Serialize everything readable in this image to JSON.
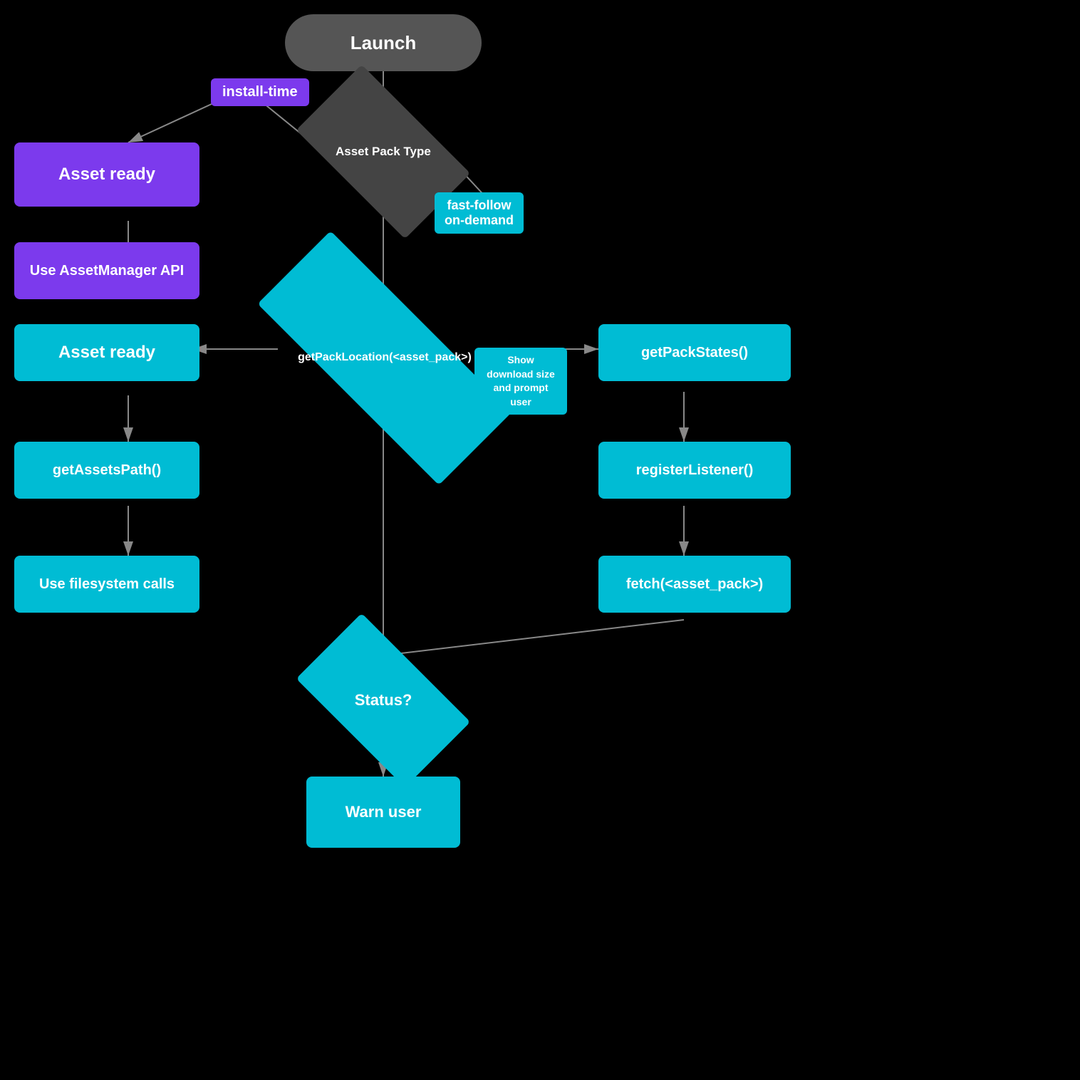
{
  "nodes": {
    "launch": {
      "label": "Launch"
    },
    "assetPackType": {
      "label": "Asset Pack Type"
    },
    "installTime": {
      "label": "install-time"
    },
    "fastFollow": {
      "label": "fast-follow\non-demand"
    },
    "assetReady1": {
      "label": "Asset ready"
    },
    "useAssetManager": {
      "label": "Use AssetManager API"
    },
    "assetReady2": {
      "label": "Asset ready"
    },
    "getPackLocation": {
      "label": "getPackLocation(<asset_pack>)"
    },
    "showDownload": {
      "label": "Show download size and prompt user"
    },
    "getAssetsPath": {
      "label": "getAssetsPath()"
    },
    "useFilesystem": {
      "label": "Use filesystem calls"
    },
    "getPackStates": {
      "label": "getPackStates()"
    },
    "registerListener": {
      "label": "registerListener()"
    },
    "fetch": {
      "label": "fetch(<asset_pack>)"
    },
    "status": {
      "label": "Status?"
    },
    "warnUser": {
      "label": "Warn user"
    }
  },
  "colors": {
    "launch": "#555555",
    "diamond_dark": "#444444",
    "diamond_teal": "#00bcd4",
    "purple": "#7c3aed",
    "teal": "#00bcd4",
    "background": "#000000",
    "arrow": "#888888"
  }
}
